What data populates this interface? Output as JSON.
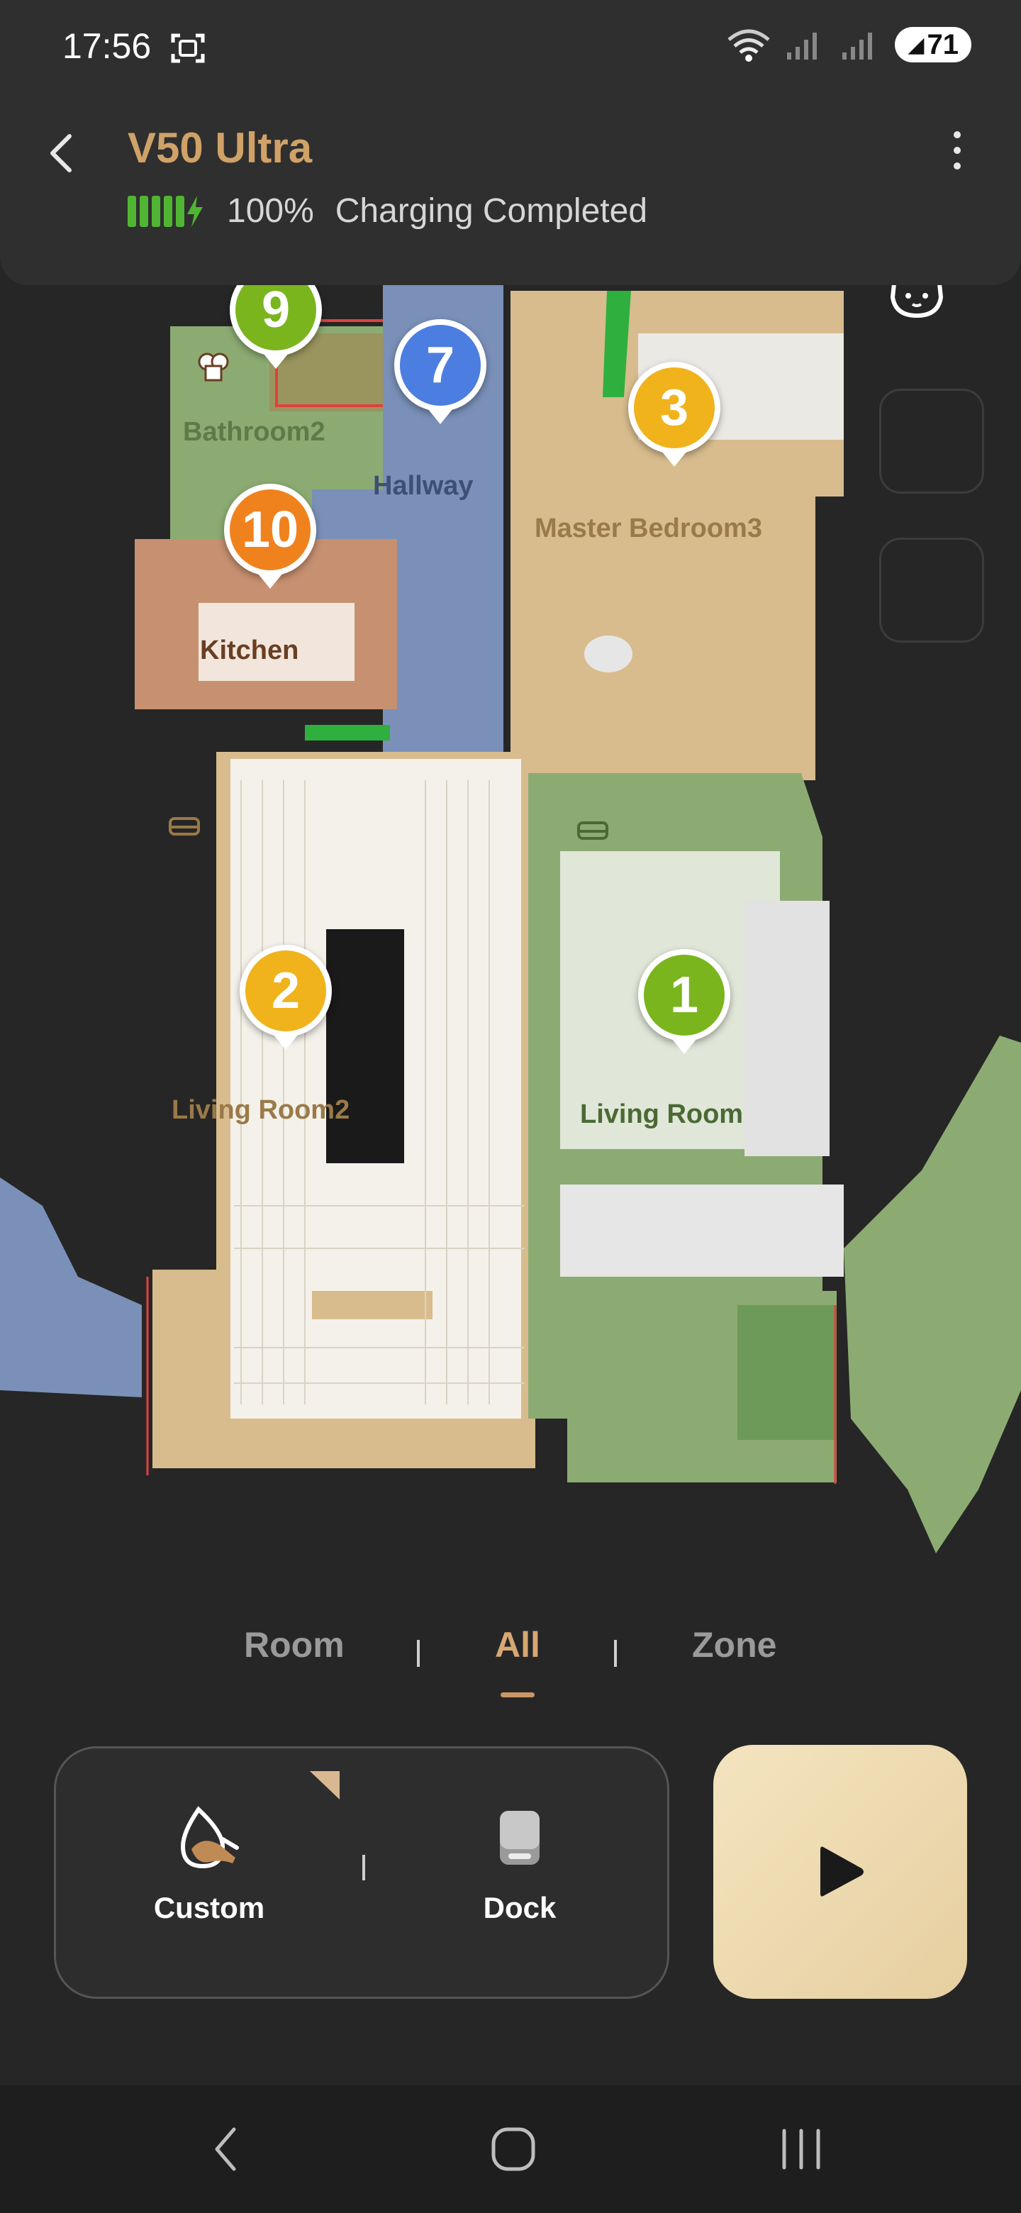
{
  "status_bar": {
    "time": "17:56",
    "battery_level": "71",
    "icons": [
      "screenshot-icon",
      "wifi-icon",
      "signal-icon",
      "battery-saver-icon"
    ]
  },
  "header": {
    "device_name": "V50 Ultra",
    "battery_percent": "100%",
    "battery_status": "Charging Completed",
    "back_icon": "chevron-left-icon",
    "menu_icon": "more-vertical-icon",
    "accent_color": "#d0a268",
    "battery_color": "#4fb532"
  },
  "map": {
    "rooms": [
      {
        "id": "bathroom2",
        "label": "Bathroom2",
        "icon": "toilet-icon",
        "color": "#8cab72",
        "label_color": "#5d7a48"
      },
      {
        "id": "hallway",
        "label": "Hallway",
        "icon": "footprints-icon",
        "color": "#7a90b8",
        "label_color": "#3e4f74"
      },
      {
        "id": "master_bedroom3",
        "label": "Master Bedroom3",
        "icon": "bed-icon",
        "color": "#d8bc8e",
        "label_color": "#9a7a48"
      },
      {
        "id": "kitchen",
        "label": "Kitchen",
        "icon": "chef-hat-icon",
        "color": "#c79070",
        "label_color": "#6a3e22"
      },
      {
        "id": "living_room2",
        "label": "Living Room2",
        "icon": "sofa-icon",
        "color": "#d8bc8e",
        "label_color": "#9a7a48"
      },
      {
        "id": "living_room",
        "label": "Living Room",
        "icon": "sofa-icon",
        "color": "#8cab72",
        "label_color": "#4a6a34"
      }
    ],
    "markers": [
      {
        "number": "9",
        "color": "#7ab51e"
      },
      {
        "number": "7",
        "color": "#4b7ee0"
      },
      {
        "number": "3",
        "color": "#f0b31c"
      },
      {
        "number": "10",
        "color": "#f0821e"
      },
      {
        "number": "2",
        "color": "#f0b31c"
      },
      {
        "number": "1",
        "color": "#7ab51e"
      }
    ],
    "side_buttons": [
      "edit-map-icon",
      "pet-mode-icon"
    ],
    "avatar": "robot-avatar"
  },
  "mode_tabs": {
    "items": [
      "Room",
      "All",
      "Zone"
    ],
    "active": "All"
  },
  "controls": {
    "custom_label": "Custom",
    "dock_label": "Dock",
    "start_icon": "play-icon",
    "start_colors": [
      "#f4e4bf",
      "#e6cfa0"
    ]
  },
  "nav_bar": {
    "buttons": [
      "back-nav-icon",
      "home-nav-icon",
      "recents-nav-icon"
    ]
  }
}
